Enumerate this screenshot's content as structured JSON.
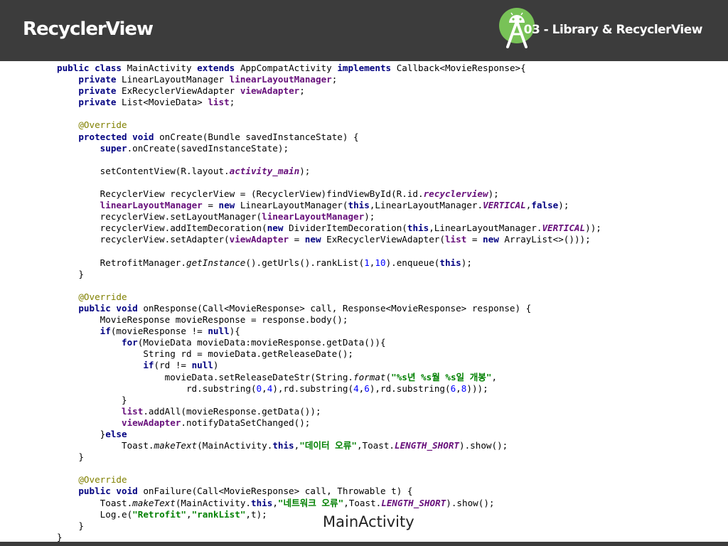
{
  "header": {
    "title": "RecyclerView",
    "section": "03 - Library & RecyclerView",
    "logo_icon": "android-studio-icon"
  },
  "code": {
    "language": "java",
    "lines": [
      [
        [
          "public class ",
          "kw"
        ],
        [
          "MainActivity ",
          ""
        ],
        [
          "extends ",
          "kw"
        ],
        [
          "AppCompatActivity ",
          ""
        ],
        [
          "implements ",
          "kw"
        ],
        [
          "Callback<MovieResponse>{",
          ""
        ]
      ],
      [
        [
          "    ",
          ""
        ],
        [
          "private ",
          "kw"
        ],
        [
          "LinearLayoutManager ",
          ""
        ],
        [
          "linearLayoutManager",
          "fld"
        ],
        [
          ";",
          ""
        ]
      ],
      [
        [
          "    ",
          ""
        ],
        [
          "private ",
          "kw"
        ],
        [
          "ExRecyclerViewAdapter ",
          ""
        ],
        [
          "viewAdapter",
          "fld"
        ],
        [
          ";",
          ""
        ]
      ],
      [
        [
          "    ",
          ""
        ],
        [
          "private ",
          "kw"
        ],
        [
          "List<MovieData> ",
          ""
        ],
        [
          "list",
          "fld"
        ],
        [
          ";",
          ""
        ]
      ],
      [],
      [
        [
          "    ",
          ""
        ],
        [
          "@Override",
          "ann"
        ]
      ],
      [
        [
          "    ",
          ""
        ],
        [
          "protected void ",
          "kw"
        ],
        [
          "onCreate(Bundle savedInstanceState) {",
          ""
        ]
      ],
      [
        [
          "        ",
          ""
        ],
        [
          "super",
          "kw"
        ],
        [
          ".onCreate(savedInstanceState);",
          ""
        ]
      ],
      [],
      [
        [
          "        setContentView(R.layout.",
          ""
        ],
        [
          "activity_main",
          "fldi"
        ],
        [
          ");",
          ""
        ]
      ],
      [],
      [
        [
          "        RecyclerView recyclerView = (RecyclerView)findViewById(R.id.",
          ""
        ],
        [
          "recyclerview",
          "fldi"
        ],
        [
          ");",
          ""
        ]
      ],
      [
        [
          "        ",
          ""
        ],
        [
          "linearLayoutManager",
          "fld"
        ],
        [
          " = ",
          ""
        ],
        [
          "new ",
          "kw"
        ],
        [
          "LinearLayoutManager(",
          ""
        ],
        [
          "this",
          "kw"
        ],
        [
          ",LinearLayoutManager.",
          ""
        ],
        [
          "VERTICAL",
          "fldi"
        ],
        [
          ",",
          ""
        ],
        [
          "false",
          "kw"
        ],
        [
          ");",
          ""
        ]
      ],
      [
        [
          "        recyclerView.setLayoutManager(",
          ""
        ],
        [
          "linearLayoutManager",
          "fld"
        ],
        [
          ");",
          ""
        ]
      ],
      [
        [
          "        recyclerView.addItemDecoration(",
          ""
        ],
        [
          "new ",
          "kw"
        ],
        [
          "DividerItemDecoration(",
          ""
        ],
        [
          "this",
          "kw"
        ],
        [
          ",LinearLayoutManager.",
          ""
        ],
        [
          "VERTICAL",
          "fldi"
        ],
        [
          "));",
          ""
        ]
      ],
      [
        [
          "        recyclerView.setAdapter(",
          ""
        ],
        [
          "viewAdapter",
          "fld"
        ],
        [
          " = ",
          ""
        ],
        [
          "new ",
          "kw"
        ],
        [
          "ExRecyclerViewAdapter(",
          ""
        ],
        [
          "list",
          "fld"
        ],
        [
          " = ",
          ""
        ],
        [
          "new ",
          "kw"
        ],
        [
          "ArrayList<>()));",
          ""
        ]
      ],
      [],
      [
        [
          "        RetrofitManager.",
          ""
        ],
        [
          "getInstance",
          "it"
        ],
        [
          "().getUrls().rankList(",
          ""
        ],
        [
          "1",
          "num"
        ],
        [
          ",",
          ""
        ],
        [
          "10",
          "num"
        ],
        [
          ").enqueue(",
          ""
        ],
        [
          "this",
          "kw"
        ],
        [
          ");",
          ""
        ]
      ],
      [
        [
          "    }",
          ""
        ]
      ],
      [],
      [
        [
          "    ",
          ""
        ],
        [
          "@Override",
          "ann"
        ]
      ],
      [
        [
          "    ",
          ""
        ],
        [
          "public void ",
          "kw"
        ],
        [
          "onResponse(Call<MovieResponse> call, Response<MovieResponse> response) {",
          ""
        ]
      ],
      [
        [
          "        MovieResponse movieResponse = response.body();",
          ""
        ]
      ],
      [
        [
          "        ",
          ""
        ],
        [
          "if",
          "kw"
        ],
        [
          "(movieResponse != ",
          ""
        ],
        [
          "null",
          "kw"
        ],
        [
          "){",
          ""
        ]
      ],
      [
        [
          "            ",
          ""
        ],
        [
          "for",
          "kw"
        ],
        [
          "(MovieData movieData:movieResponse.getData()){",
          ""
        ]
      ],
      [
        [
          "                String rd = movieData.getReleaseDate();",
          ""
        ]
      ],
      [
        [
          "                ",
          ""
        ],
        [
          "if",
          "kw"
        ],
        [
          "(rd != ",
          ""
        ],
        [
          "null",
          "kw"
        ],
        [
          ")",
          ""
        ]
      ],
      [
        [
          "                    movieData.setReleaseDateStr(String.",
          ""
        ],
        [
          "format",
          "it"
        ],
        [
          "(",
          ""
        ],
        [
          "\"%s년 %s월 %s일 개봉\"",
          "str"
        ],
        [
          ",",
          ""
        ]
      ],
      [
        [
          "                        rd.substring(",
          ""
        ],
        [
          "0",
          "num"
        ],
        [
          ",",
          ""
        ],
        [
          "4",
          "num"
        ],
        [
          "),rd.substring(",
          ""
        ],
        [
          "4",
          "num"
        ],
        [
          ",",
          ""
        ],
        [
          "6",
          "num"
        ],
        [
          "),rd.substring(",
          ""
        ],
        [
          "6",
          "num"
        ],
        [
          ",",
          ""
        ],
        [
          "8",
          "num"
        ],
        [
          ")));",
          ""
        ]
      ],
      [
        [
          "            }",
          ""
        ]
      ],
      [
        [
          "            ",
          ""
        ],
        [
          "list",
          "fld"
        ],
        [
          ".addAll(movieResponse.getData());",
          ""
        ]
      ],
      [
        [
          "            ",
          ""
        ],
        [
          "viewAdapter",
          "fld"
        ],
        [
          ".notifyDataSetChanged();",
          ""
        ]
      ],
      [
        [
          "        }",
          ""
        ],
        [
          "else",
          "kw"
        ]
      ],
      [
        [
          "            Toast.",
          ""
        ],
        [
          "makeText",
          "it"
        ],
        [
          "(MainActivity.",
          ""
        ],
        [
          "this",
          "kw"
        ],
        [
          ",",
          ""
        ],
        [
          "\"데이터 오류\"",
          "str"
        ],
        [
          ",Toast.",
          ""
        ],
        [
          "LENGTH_SHORT",
          "fldi"
        ],
        [
          ").show();",
          ""
        ]
      ],
      [
        [
          "    }",
          ""
        ]
      ],
      [],
      [
        [
          "    ",
          ""
        ],
        [
          "@Override",
          "ann"
        ]
      ],
      [
        [
          "    ",
          ""
        ],
        [
          "public void ",
          "kw"
        ],
        [
          "onFailure(Call<MovieResponse> call, Throwable t) {",
          ""
        ]
      ],
      [
        [
          "        Toast.",
          ""
        ],
        [
          "makeText",
          "it"
        ],
        [
          "(MainActivity.",
          ""
        ],
        [
          "this",
          "kw"
        ],
        [
          ",",
          ""
        ],
        [
          "\"네트워크 오류\"",
          "str"
        ],
        [
          ",Toast.",
          ""
        ],
        [
          "LENGTH_SHORT",
          "fldi"
        ],
        [
          ").show();",
          ""
        ]
      ],
      [
        [
          "        Log.e(",
          ""
        ],
        [
          "\"Retrofit\"",
          "str"
        ],
        [
          ",",
          ""
        ],
        [
          "\"rankList\"",
          "str"
        ],
        [
          ",t);",
          ""
        ]
      ],
      [
        [
          "    }",
          ""
        ]
      ],
      [
        [
          "}",
          ""
        ]
      ]
    ]
  },
  "caption": "MainActivity",
  "colors": {
    "header_bg": "#3c3c3c",
    "keyword": "#000080",
    "field": "#660e7a",
    "annotation": "#808000",
    "number": "#0000ff",
    "string": "#008000",
    "logo_green": "#78c257"
  }
}
